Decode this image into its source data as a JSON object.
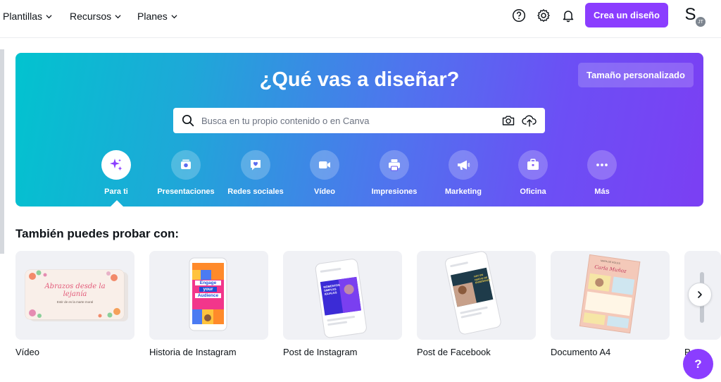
{
  "nav": {
    "items": [
      {
        "label": "Plantillas"
      },
      {
        "label": "Recursos"
      },
      {
        "label": "Planes"
      }
    ],
    "create_label": "Crea un diseño",
    "avatar_initials": "S",
    "avatar_badge": "JT",
    "icons": [
      "help-circle-icon",
      "gear-icon",
      "bell-icon"
    ]
  },
  "hero": {
    "title": "¿Qué vas a diseñar?",
    "custom_size_label": "Tamaño personalizado",
    "search_placeholder": "Busca en tu propio contenido o en Canva",
    "search_value": "",
    "categories": [
      {
        "label": "Para ti",
        "icon": "sparkle-icon",
        "active": true
      },
      {
        "label": "Presentaciones",
        "icon": "presentation-icon",
        "active": false
      },
      {
        "label": "Redes sociales",
        "icon": "heart-chat-icon",
        "active": false
      },
      {
        "label": "Vídeo",
        "icon": "video-camera-icon",
        "active": false
      },
      {
        "label": "Impresiones",
        "icon": "printer-icon",
        "active": false
      },
      {
        "label": "Marketing",
        "icon": "megaphone-icon",
        "active": false
      },
      {
        "label": "Oficina",
        "icon": "briefcase-icon",
        "active": false
      },
      {
        "label": "Más",
        "icon": "more-dots-icon",
        "active": false
      }
    ]
  },
  "suggestions": {
    "title": "También puedes probar con:",
    "cards": [
      {
        "label": "Vídeo",
        "thumb_text": "Abrazos desde la lejanía",
        "thumb_subtext": "Estir de es la marte moral"
      },
      {
        "label": "Historia de Instagram",
        "thumb_lines": [
          "Engage",
          "your",
          "Audience"
        ]
      },
      {
        "label": "Post de Instagram",
        "thumb_text": "MOMENTOS SIMPLES IGUALES"
      },
      {
        "label": "Post de Facebook",
        "thumb_text": "HAY UN NUEVO DE ENSEÑANZA"
      },
      {
        "label": "Documento A4",
        "thumb_text": "Carla Muñoz",
        "thumb_subtext": "MAPA DE ROLES"
      },
      {
        "label": "P"
      }
    ]
  },
  "help_label": "?",
  "colors": {
    "brand_purple": "#8b3dff",
    "hero_start": "#02c3cf",
    "hero_end": "#7b3ff3"
  }
}
